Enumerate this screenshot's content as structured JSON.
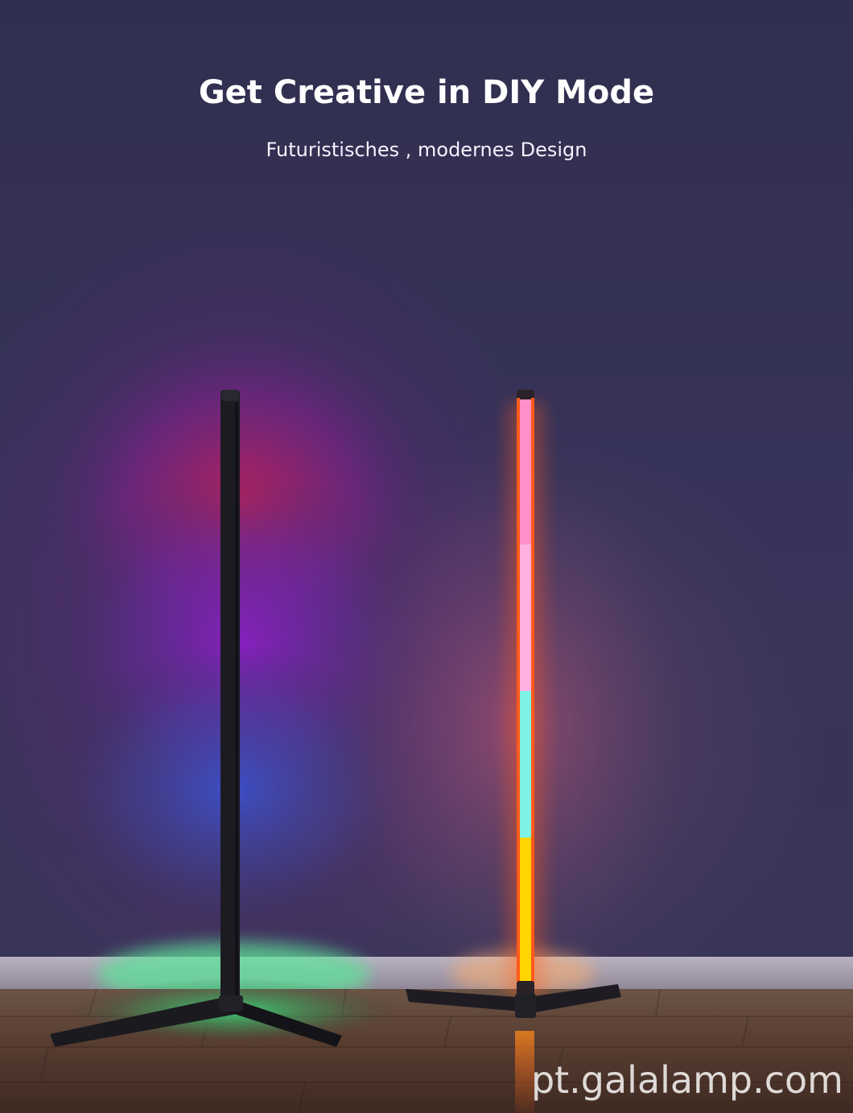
{
  "headline": "Get Creative in DIY Mode",
  "subheadline": "Futuristisches , modernes Design",
  "watermark": "pt.galalamp.com",
  "colors": {
    "wall": "#34315a",
    "floor": "#6a4a3a",
    "left_glow_top": "#c41e5a",
    "left_glow_mid": "#7a1fb0",
    "left_glow_low": "#3a54c8",
    "left_glow_floor": "#3ddc7a",
    "lamp_segment_pink": "#ff8fc9",
    "lamp_segment_light_pink": "#ffb0e0",
    "lamp_segment_cyan": "#7ff2e6",
    "lamp_segment_yellow": "#ffd400",
    "lamp_glow_orange": "#ff5a1a"
  }
}
